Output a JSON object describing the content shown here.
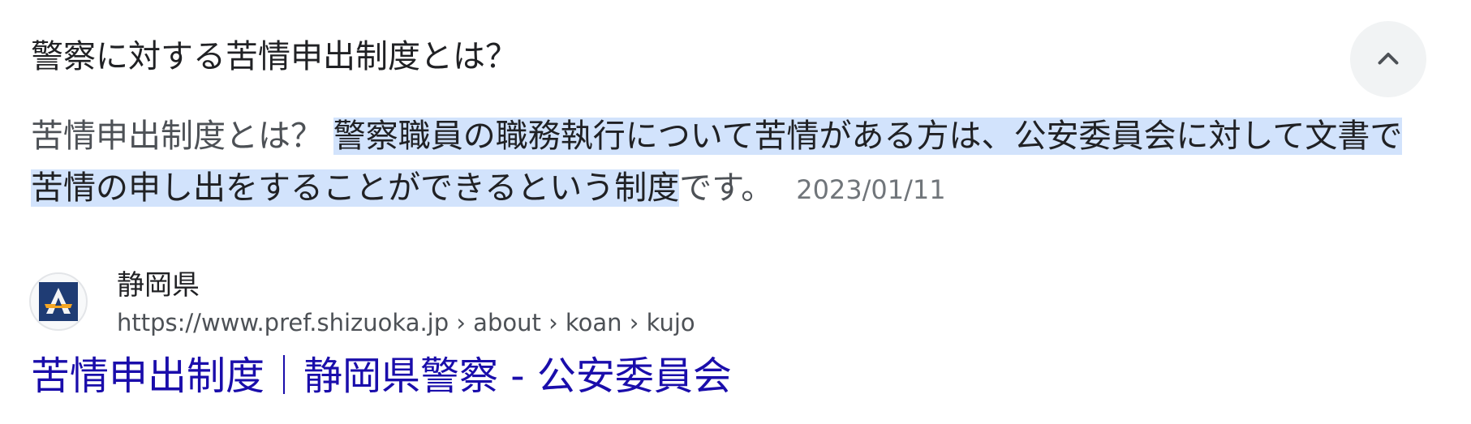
{
  "question": {
    "text": "警察に対する苦情申出制度とは？",
    "collapse_icon": "chevron-up-icon"
  },
  "snippet": {
    "lead": "苦情申出制度とは？ ",
    "highlight": "警察職員の職務執行について苦情がある方は、公安委員会に対して文書で苦情の申し出をすることができるという制度",
    "tail": "です。",
    "date": "2023/01/11"
  },
  "source": {
    "site_name": "静岡県",
    "url": "https://www.pref.shizuoka.jp › about › koan › kujo",
    "favicon_icon": "shizuoka-police-emblem-icon",
    "favicon_colors": {
      "bg": "#1f3c74",
      "mark": "#f4f4f4",
      "accent": "#f5a623"
    }
  },
  "result": {
    "title": "苦情申出制度｜静岡県警察 - 公安委員会"
  }
}
